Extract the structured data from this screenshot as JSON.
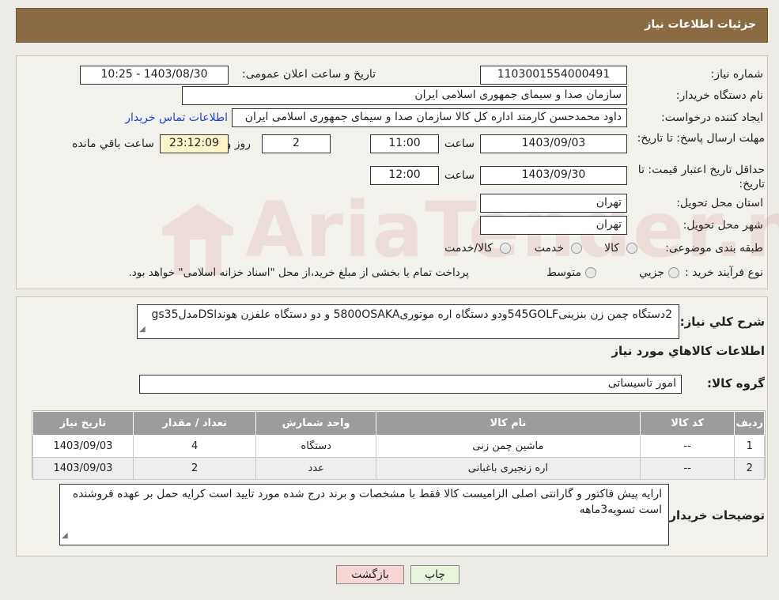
{
  "header": {
    "title": "جزئیات اطلاعات نیاز"
  },
  "fields": {
    "need_number_label": "شماره نیاز:",
    "need_number": "1103001554000491",
    "announce_label": "تاریخ و ساعت اعلان عمومی:",
    "announce_value": "1403/08/30 - 10:25",
    "buyer_org_label": "نام دستگاه خریدار:",
    "buyer_org": "سازمان صدا و سیمای جمهوری اسلامی ایران",
    "creator_label": "ایجاد کننده درخواست:",
    "creator": "داود محمدحسن کارمند اداره کل کالا سازمان صدا و سیمای جمهوری اسلامی ایران",
    "contact_link": "اطلاعات تماس خریدار",
    "deadline_label": "مهلت ارسال پاسخ: تا تاریخ:",
    "deadline_date": "1403/09/03",
    "time_label": "ساعت",
    "deadline_time": "11:00",
    "days": "2",
    "days_label": "روز و",
    "remaining": "23:12:09",
    "remaining_label": "ساعت باقي مانده",
    "validity_label": "حداقل تاریخ اعتبار قیمت: تا تاریخ:",
    "validity_date": "1403/09/30",
    "validity_time": "12:00",
    "province_label": "استان محل تحویل:",
    "province": "تهران",
    "city_label": "شهر محل تحویل:",
    "city": "تهران",
    "category_label": "طبقه بندی موضوعی:",
    "category_options": [
      "کالا",
      "خدمت",
      "کالا/خدمت"
    ],
    "process_label": "نوع فرآیند خرید :",
    "process_options": [
      "جزيي",
      "متوسط"
    ],
    "process_note": "پرداخت تمام یا بخشی از مبلغ خرید،از محل \"اسناد خزانه اسلامی\" خواهد بود."
  },
  "summary": {
    "label": "شرح کلي نياز:",
    "text": "2دستگاه چمن زن بنزینی545GOLFودو دستگاه اره موتوری5800OSAKA و دو دستگاه علفزن هونداDSمدلgs35",
    "goods_info_title": "اطلاعات کالاهاي مورد نياز",
    "group_label": "گروه کالا:",
    "group_value": "امور تاسیساتی"
  },
  "table": {
    "headers": [
      "رديف",
      "کد کالا",
      "نام کالا",
      "واحد شمارش",
      "تعداد / مقدار",
      "تاریخ نیاز"
    ],
    "rows": [
      [
        "1",
        "--",
        "ماشین چمن زنی",
        "دستگاه",
        "4",
        "1403/09/03"
      ],
      [
        "2",
        "--",
        "اره زنجیری باغبانی",
        "عدد",
        "2",
        "1403/09/03"
      ]
    ]
  },
  "notes": {
    "label": "توضیحات خریدار:",
    "text": "ارایه پیش فاکتور و گارانتی اصلی الزامیست کالا فقط با مشخصات و برند درج شده مورد تایید است کرایه حمل بر عهده فروشنده است  تسویه3ماهه"
  },
  "buttons": {
    "print": "چاپ",
    "back": "بازگشت"
  },
  "watermark": {
    "text": "AriaTender.neT"
  },
  "colors": {
    "header_bg": "#8b6c42",
    "back_btn_bg": "#f7d6d6",
    "print_btn_bg": "#e6f5dc",
    "link": "#1a44cc",
    "table_head": "#9c9c9c"
  }
}
